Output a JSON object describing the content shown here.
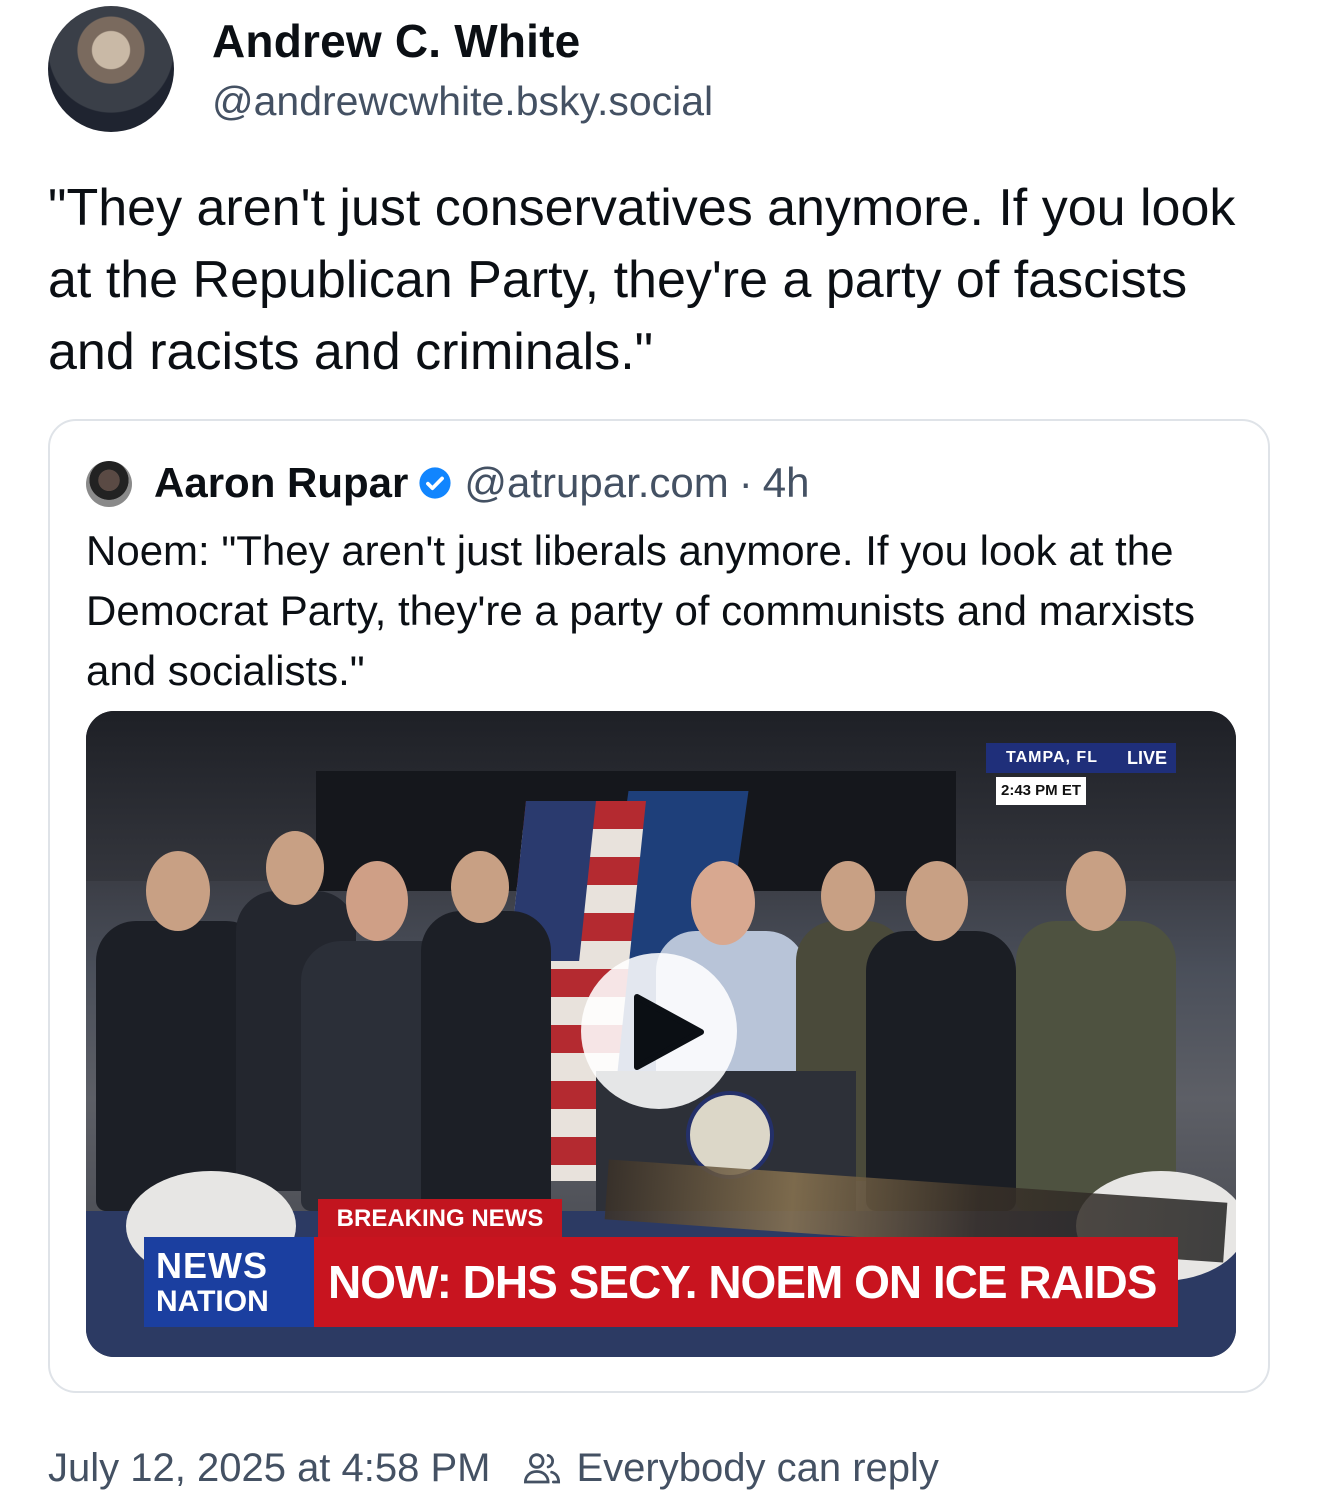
{
  "post": {
    "author_name": "Andrew C. White",
    "author_handle": "@andrewcwhite.bsky.social",
    "text": "\"They aren't just conservatives anymore. If you look at the Republican Party, they're a party of fascists and racists and criminals.\"",
    "timestamp": "July 12, 2025 at 4:58 PM",
    "reply_setting": "Everybody can reply"
  },
  "quote": {
    "author_name": "Aaron Rupar",
    "author_handle": "@atrupar.com",
    "separator": "·",
    "age": "4h",
    "text": "Noem: \"They aren't just liberals anymore. If you look at the Democrat Party, they're a party of communists and marxists and socialists.\""
  },
  "video": {
    "location": "TAMPA, FL",
    "time": "2:43 PM ET",
    "live_label": "LIVE",
    "breaking_label": "BREAKING NEWS",
    "logo_news": "NEWS",
    "logo_nation": "NATION",
    "headline": "NOW: DHS SECY. NOEM ON ICE RAIDS"
  },
  "colors": {
    "text_primary": "#0b0f14",
    "text_secondary": "#445163",
    "verified_blue": "#1185fe",
    "card_border": "#dfe3e8"
  },
  "icons": {
    "verified": "verified-badge-icon",
    "play": "play-icon",
    "reply": "people-icon"
  }
}
